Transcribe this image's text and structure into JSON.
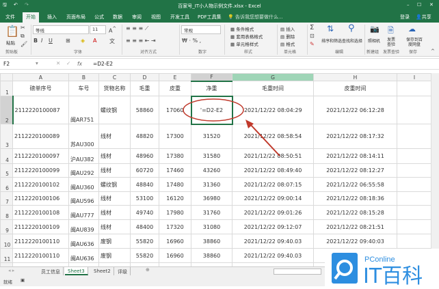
{
  "window": {
    "title": "百家号_IT小人物示例文件.xlsx - Excel",
    "login": "登录",
    "share": "共享"
  },
  "tabs": [
    "文件",
    "开始",
    "插入",
    "页面布局",
    "公式",
    "数据",
    "审阅",
    "视图",
    "开发工具",
    "PDF工具集"
  ],
  "tell_me": "告诉我您想要做什么...",
  "ribbon": {
    "paste": "粘贴",
    "clipboard": "剪贴板",
    "font_name": "等线",
    "font_size": "11",
    "font_group": "字体",
    "bold": "B",
    "italic": "I",
    "underline": "U",
    "align_group": "对齐方式",
    "number_format": "常规",
    "number_group": "数字",
    "cond_format": "条件格式",
    "table_format": "套用表格格式",
    "cell_style": "单元格样式",
    "styles_group": "样式",
    "insert": "插入",
    "delete": "删除",
    "format": "格式",
    "cells_group": "单元格",
    "sort_filter": "排序和筛选",
    "find_select": "查找和选择",
    "editing_group": "编辑",
    "camera": "照相机",
    "new_group": "新建组",
    "invoice_check": "发票查验",
    "invoice_group": "发票查验",
    "save_baidu": "保存到百度网盘",
    "save_group": "保存"
  },
  "formula_bar": {
    "name_box": "F2",
    "formula": "=D2-E2",
    "fx": "fx"
  },
  "columns": [
    "A",
    "B",
    "C",
    "D",
    "E",
    "F",
    "G",
    "H",
    "I"
  ],
  "header_row": [
    "磅单序号",
    "车号",
    "货物名称",
    "毛重",
    "皮重",
    "净重",
    "毛重时间",
    "皮重时间",
    ""
  ],
  "rows": [
    [
      "2112220100087",
      "闽AR751",
      "螺纹钢",
      "58860",
      "17060",
      "'=D2-E2",
      "2021/12/22 08:04:29",
      "2021/12/22 06:12:28",
      ""
    ],
    [
      "2112220100089",
      "苏AU300",
      "线材",
      "48820",
      "17300",
      "31520",
      "2021/12/22 08:58:54",
      "2021/12/22 08:17:32",
      ""
    ],
    [
      "2112220100097",
      "沪AU382",
      "线材",
      "48960",
      "17380",
      "31580",
      "2021/12/22 08:50:51",
      "2021/12/22 08:14:11",
      ""
    ],
    [
      "2112220100099",
      "闽AU292",
      "线材",
      "60720",
      "17460",
      "43260",
      "2021/12/22 08:49:40",
      "2021/12/22 08:12:27",
      ""
    ],
    [
      "2112220100102",
      "闽AU360",
      "螺纹钢",
      "48840",
      "17480",
      "31360",
      "2021/12/22 08:07:15",
      "2021/12/22 06:55:58",
      ""
    ],
    [
      "2112220100106",
      "闽AU596",
      "线材",
      "53100",
      "16120",
      "36980",
      "2021/12/22 09:00:14",
      "2021/12/22 08:18:36",
      ""
    ],
    [
      "2112220100108",
      "闽AU777",
      "线材",
      "49740",
      "17980",
      "31760",
      "2021/12/22 09:01:26",
      "2021/12/22 08:15:28",
      ""
    ],
    [
      "2112220100109",
      "闽AU839",
      "线材",
      "48400",
      "17320",
      "31080",
      "2021/12/22 09:12:07",
      "2021/12/22 08:21:51",
      ""
    ],
    [
      "2112220100110",
      "闽AU636",
      "废钢",
      "55820",
      "16960",
      "38860",
      "2021/12/22 09:40.03",
      "2021/12/22 09:40:03",
      ""
    ],
    [
      "2112220100110",
      "闽AU636",
      "废钢",
      "55820",
      "16960",
      "38860",
      "2021/12/22 09:40.03",
      "",
      ""
    ]
  ],
  "sheets": [
    "员工信息",
    "Sheet3",
    "Sheet2",
    "评级"
  ],
  "active_sheet": "Sheet3",
  "status": "就绪",
  "watermark": "PConline IT百科",
  "colors": {
    "excel_green": "#217346",
    "annotation_red": "#c0392b",
    "logo_blue": "#2d8ee0"
  }
}
